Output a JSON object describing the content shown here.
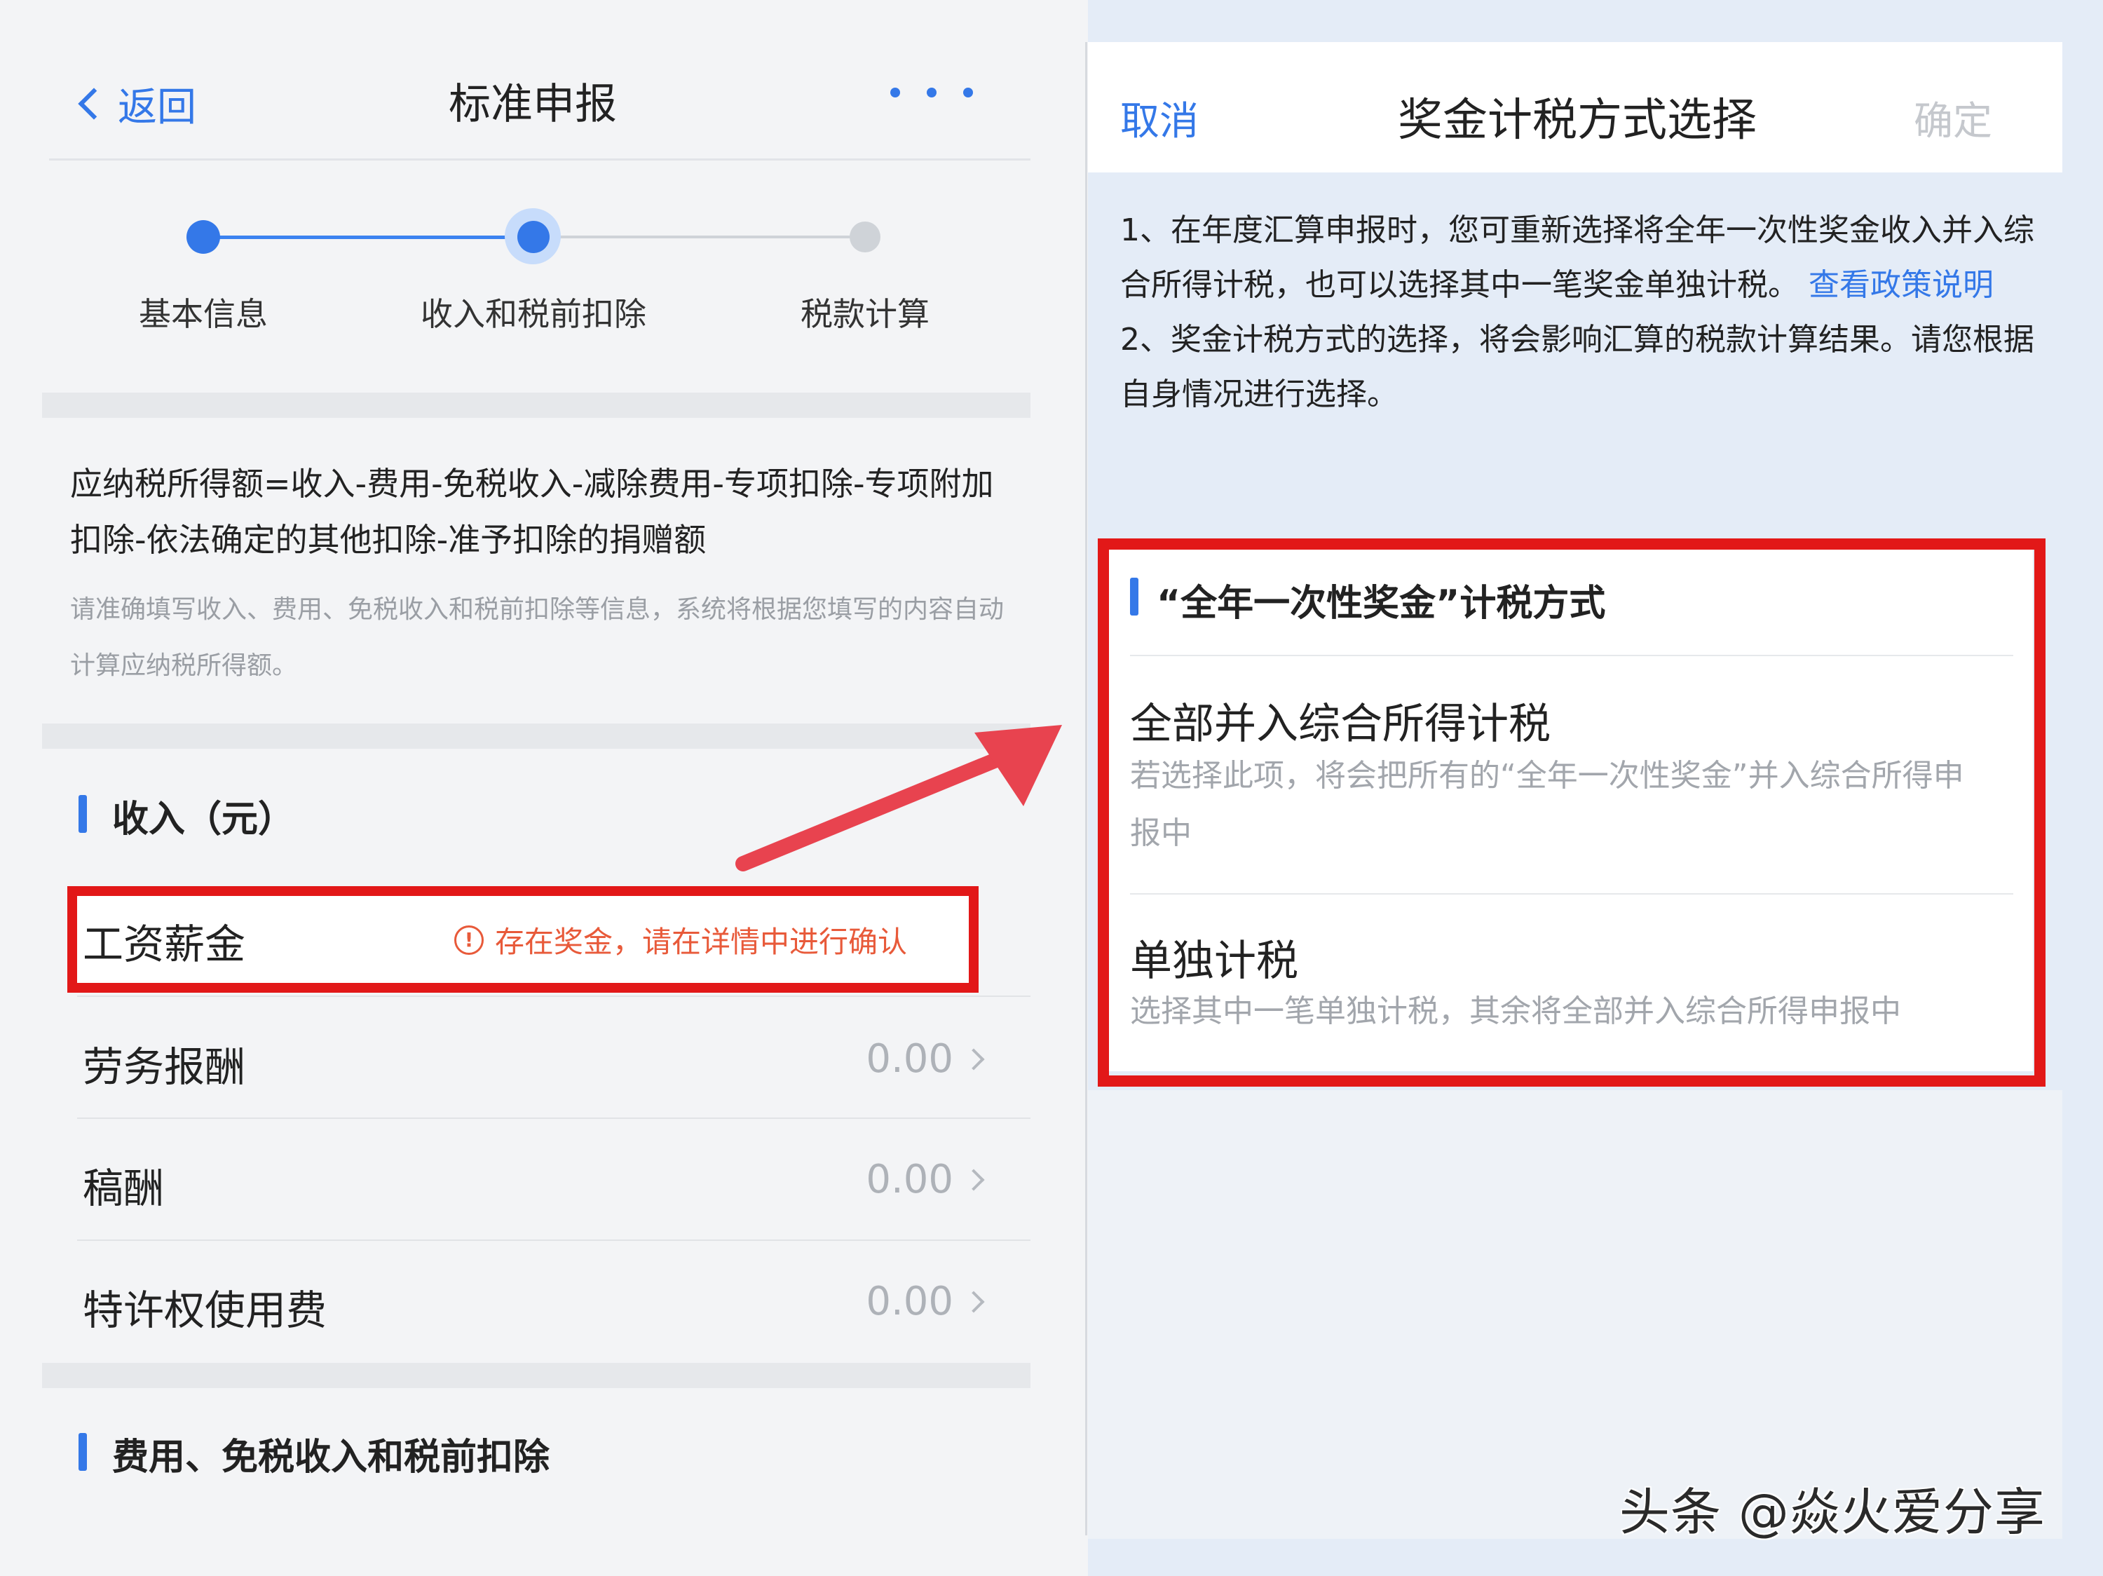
{
  "left": {
    "nav": {
      "back_label": "返回",
      "title": "标准申报"
    },
    "steps": [
      {
        "label": "基本信息",
        "state": "done"
      },
      {
        "label": "收入和税前扣除",
        "state": "current"
      },
      {
        "label": "税款计算",
        "state": "pending"
      }
    ],
    "formula": "应纳税所得额=收入-费用-免税收入-减除费用-专项扣除-专项附加扣除-依法确定的其他扣除-准予扣除的捐赠额",
    "hint": "请准确填写收入、费用、免税收入和税前扣除等信息，系统将根据您填写的内容自动计算应纳税所得额。",
    "income_section": {
      "title": "收入（元）",
      "rows": [
        {
          "label": "工资薪金",
          "warning": "存在奖金，请在详情中进行确认"
        },
        {
          "label": "劳务报酬",
          "value": "0.00"
        },
        {
          "label": "稿酬",
          "value": "0.00"
        },
        {
          "label": "特许权使用费",
          "value": "0.00"
        }
      ]
    },
    "expense_section": {
      "title": "费用、免税收入和税前扣除"
    }
  },
  "right": {
    "header": {
      "cancel_label": "取消",
      "title": "奖金计税方式选择",
      "confirm_label": "确定"
    },
    "notice": {
      "line1_text": "1、在年度汇算申报时，您可重新选择将全年一次性奖金收入并入综合所得计税，也可以选择其中一笔奖金单独计税。",
      "line1_link": "查看政策说明",
      "line2_text": "2、奖金计税方式的选择，将会影响汇算的税款计算结果。请您根据自身情况进行选择。"
    },
    "card": {
      "title": "“全年一次性奖金”计税方式",
      "options": [
        {
          "title": "全部并入综合所得计税",
          "desc": "若选择此项，将会把所有的“全年一次性奖金”并入综合所得申报中"
        },
        {
          "title": "单独计税",
          "desc": "选择其中一笔单独计税，其余将全部并入综合所得申报中"
        }
      ]
    }
  },
  "watermark": "头条 @焱火爱分享",
  "colors": {
    "accent": "#3478e8",
    "highlight_red": "#e21818",
    "warning": "#e85a3a",
    "arrow": "#e8434f"
  }
}
